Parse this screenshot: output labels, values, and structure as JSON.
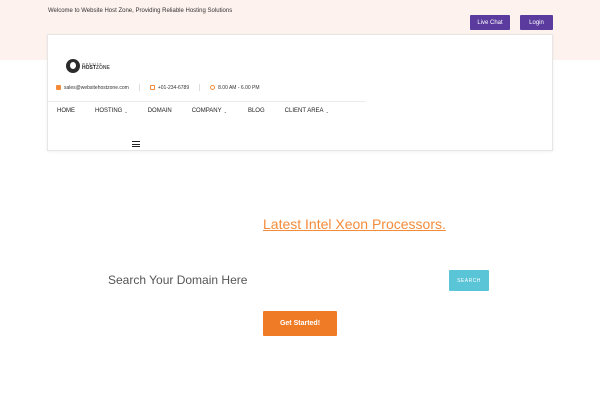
{
  "topbar": {
    "welcome": "Welcome to Website Host Zone, Providing Reliable Hosting Solutions",
    "live_chat": "Live Chat",
    "login": "Login"
  },
  "logo": {
    "top": "website",
    "bottom_a": "HOST",
    "bottom_b": "ZONE"
  },
  "contact": {
    "email": "sales@websitehostzone.com",
    "phone": "+01-234-6789",
    "hours": "8.00 AM - 6.00 PM"
  },
  "nav": {
    "items": [
      {
        "label": "HOME",
        "dropdown": false
      },
      {
        "label": "HOSTING",
        "dropdown": true
      },
      {
        "label": "DOMAIN",
        "dropdown": false
      },
      {
        "label": "COMPANY",
        "dropdown": true
      },
      {
        "label": "BLOG",
        "dropdown": false
      },
      {
        "label": "CLIENT AREA",
        "dropdown": true
      }
    ]
  },
  "hero": {
    "promo": "Latest Intel Xeon Processors.",
    "search_placeholder": "Search Your Domain Here",
    "search_button": "SEARCH",
    "cta": "Get Started!"
  },
  "colors": {
    "top_band": "#fdf2ee",
    "purple": "#5b3c9e",
    "orange": "#f07b27",
    "teal": "#5bc5d8"
  },
  "icons": {
    "email": "mail-icon",
    "phone": "phone-icon",
    "hours": "clock-icon",
    "menu": "hamburger-menu-icon"
  }
}
